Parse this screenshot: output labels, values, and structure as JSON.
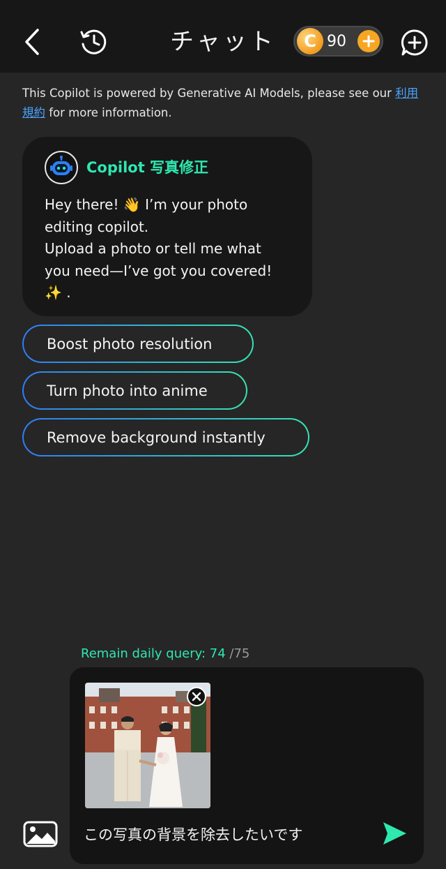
{
  "header": {
    "title": "チャット",
    "credits": "90",
    "coin_letter": "C",
    "icons": [
      "back-arrow-icon",
      "history-icon",
      "plus-icon",
      "new-chat-icon"
    ]
  },
  "notice": {
    "text": "This Copilot is powered by Generative AI Models, please see our ",
    "link": "利用規約",
    "text_after": " for more information."
  },
  "bot": {
    "name": "Copilot 写真修正",
    "message": "Hey there! 👋 I’m your photo\nediting copilot.\nUpload a photo or tell me what\nyou need—I’ve got you covered!\n✨ ."
  },
  "suggestions": [
    {
      "label": "Boost photo resolution"
    },
    {
      "label": "Turn photo into anime"
    },
    {
      "label": "Remove background instantly"
    }
  ],
  "quota": {
    "label": "Remain daily query: ",
    "remaining": "74",
    "total": " /75"
  },
  "composer": {
    "text": "この写真の背景を除去したいです",
    "attachment_icon": "close-icon",
    "send_icon": "send-icon"
  },
  "colors": {
    "accent": "#2ee8b0",
    "link": "#4aa3ff",
    "coin": "#f6a623",
    "chip_gradient_start": "#2f7df6",
    "chip_gradient_end": "#37e3b2"
  }
}
